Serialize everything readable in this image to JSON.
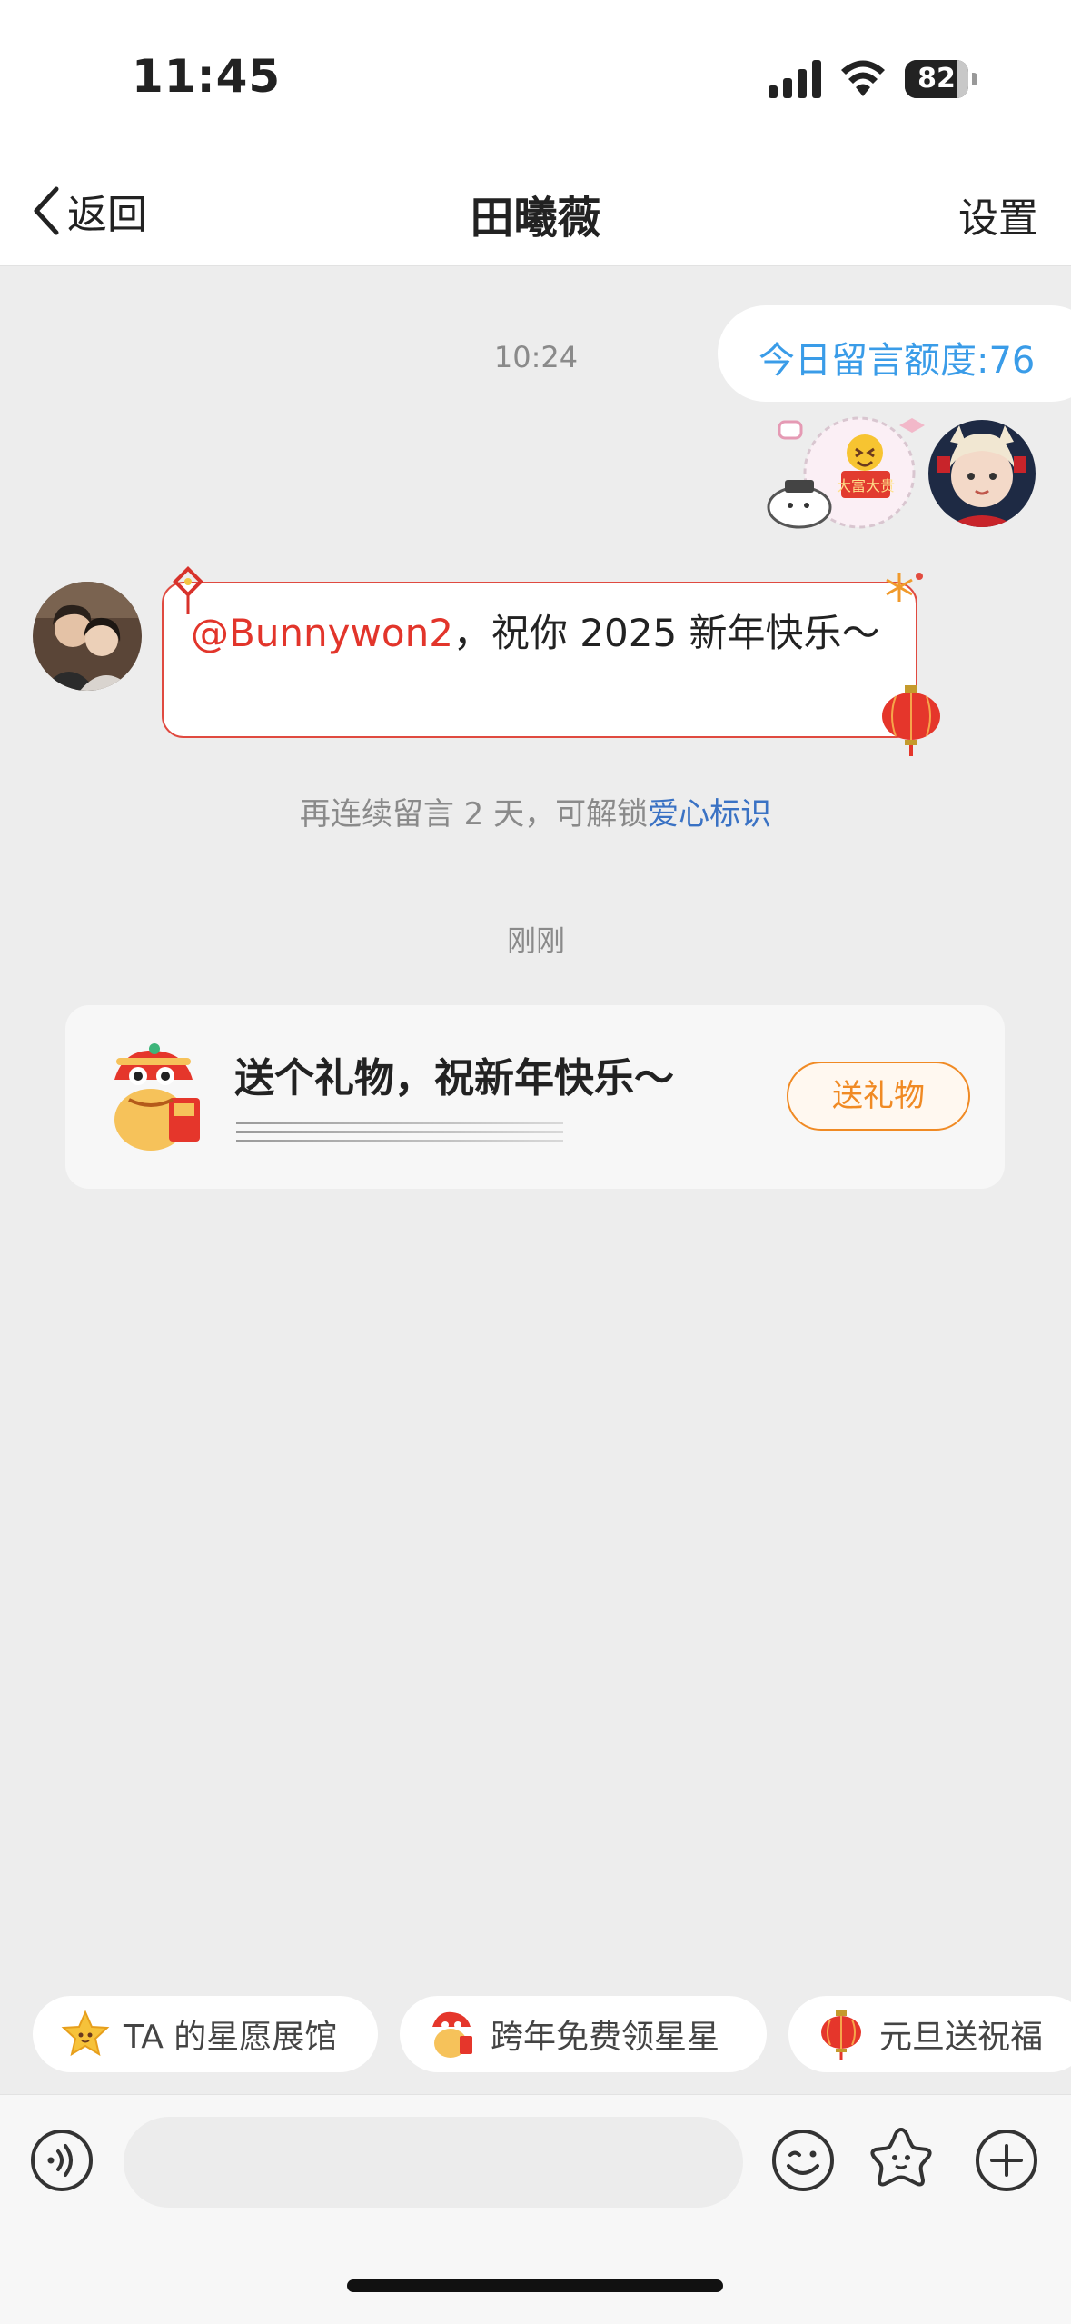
{
  "status": {
    "time": "11:45",
    "battery": "82",
    "battery_level": 0.82
  },
  "nav": {
    "back_label": "返回",
    "title": "田曦薇",
    "settings_label": "设置"
  },
  "chat": {
    "timestamp_1": "10:24",
    "quota_text": "今日留言额度:76",
    "sticker_text": "大富大贵",
    "message_mention": "@Bunnywon2",
    "message_text": "，祝你 2025 新年快乐～",
    "unlock_prefix": "再连续留言 2 天，可解锁",
    "unlock_link": "爱心标识",
    "timestamp_2": "刚刚"
  },
  "gift_card": {
    "title": "送个礼物，祝新年快乐～",
    "button_label": "送礼物"
  },
  "chips": [
    {
      "label": "TA 的星愿展馆",
      "icon": "star-icon"
    },
    {
      "label": "跨年免费领星星",
      "icon": "lion-dance-icon"
    },
    {
      "label": "元旦送祝福",
      "icon": "lantern-icon"
    }
  ],
  "input": {
    "placeholder": ""
  },
  "colors": {
    "accent_blue": "#3a9ce8",
    "mention_red": "#e2352b",
    "gift_orange": "#f08a24",
    "link_blue": "#3a72c4"
  }
}
